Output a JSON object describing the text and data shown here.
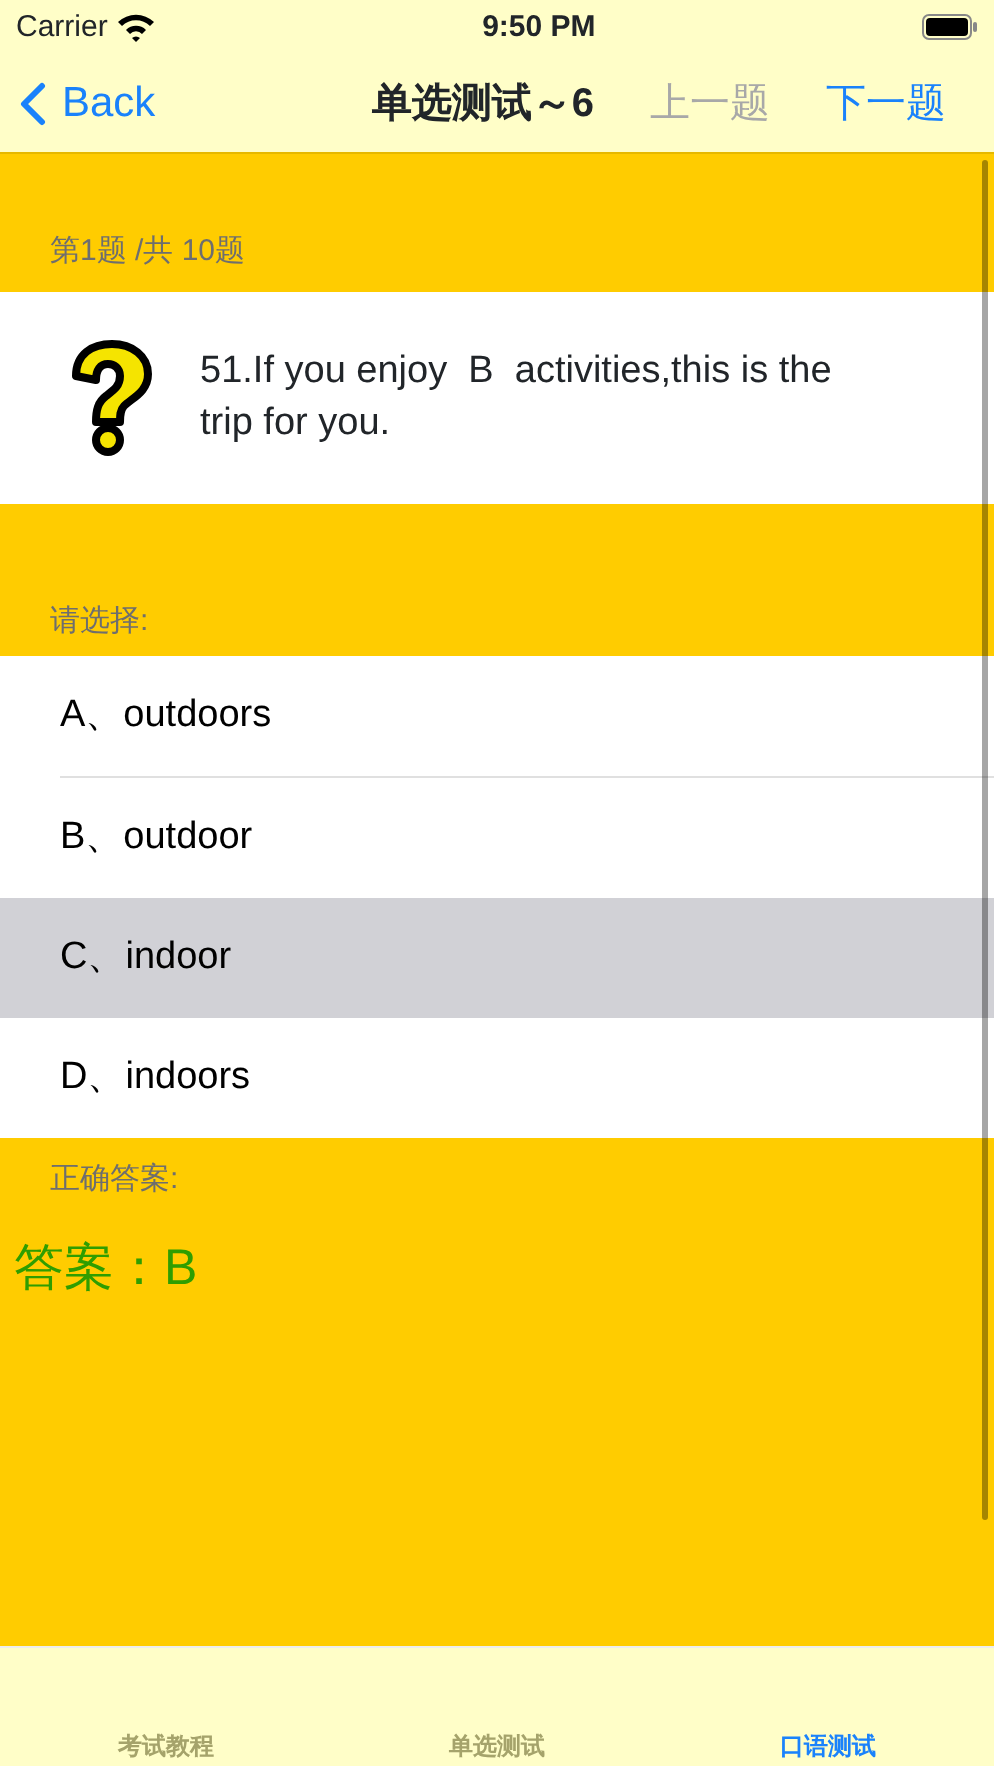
{
  "status_bar": {
    "carrier": "Carrier",
    "time": "9:50 PM"
  },
  "nav": {
    "back": "Back",
    "title": "单选测试～6",
    "buttons": [
      {
        "label": "上一题",
        "disabled": true
      },
      {
        "label": "下一题",
        "disabled": false
      }
    ]
  },
  "progress": "第1题 /共 10题",
  "question": "51.If you enjoy  B  activities,this is the trip for you.",
  "choose_label": "请选择:",
  "options": [
    {
      "label": "A、outdoors",
      "selected": false
    },
    {
      "label": "B、outdoor",
      "selected": false
    },
    {
      "label": "C、indoor",
      "selected": true
    },
    {
      "label": "D、indoors",
      "selected": false
    }
  ],
  "answer_label": "正确答案:",
  "answer": "答案：B",
  "tabs": [
    {
      "label": "考试教程",
      "selected": false
    },
    {
      "label": "单选测试",
      "selected": false
    },
    {
      "label": "口语测试",
      "selected": true
    }
  ]
}
